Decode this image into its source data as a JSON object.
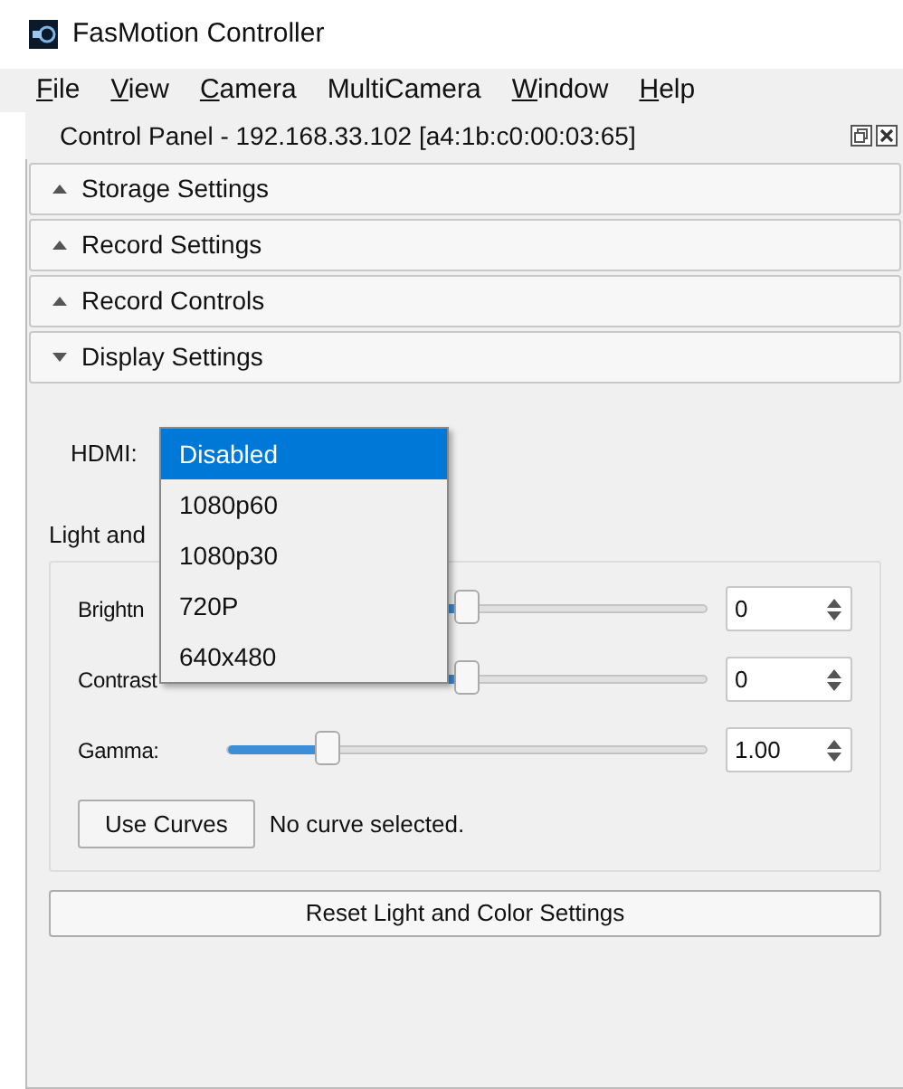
{
  "window": {
    "title": "FasMotion Controller"
  },
  "menu": [
    {
      "label": "File",
      "mnemonic": true
    },
    {
      "label": "View",
      "mnemonic": true
    },
    {
      "label": "Camera",
      "mnemonic": true
    },
    {
      "label": "MultiCamera",
      "mnemonic": false
    },
    {
      "label": "Window",
      "mnemonic": true
    },
    {
      "label": "Help",
      "mnemonic": true
    }
  ],
  "panel": {
    "title": "Control Panel - 192.168.33.102 [a4:1b:c0:00:03:65]"
  },
  "sections": [
    {
      "label": "Storage Settings",
      "expanded": false
    },
    {
      "label": "Record Settings",
      "expanded": false
    },
    {
      "label": "Record Controls",
      "expanded": false
    },
    {
      "label": "Display Settings",
      "expanded": true
    }
  ],
  "hdmi": {
    "label": "HDMI:",
    "options": [
      {
        "label": "Disabled",
        "selected": true
      },
      {
        "label": "1080p60",
        "selected": false
      },
      {
        "label": "1080p30",
        "selected": false
      },
      {
        "label": "720P",
        "selected": false
      },
      {
        "label": "640x480",
        "selected": false
      }
    ]
  },
  "light_group": {
    "title": "Light and"
  },
  "sliders": [
    {
      "label": "Brightn",
      "level": 0.5,
      "value": "0"
    },
    {
      "label": "Contrast",
      "level": 0.5,
      "value": "0"
    },
    {
      "label": "Gamma:",
      "level": 0.21,
      "value": "1.00"
    }
  ],
  "curves": {
    "button": "Use Curves",
    "status": "No curve selected."
  },
  "reset_button": "Reset Light and Color Settings"
}
